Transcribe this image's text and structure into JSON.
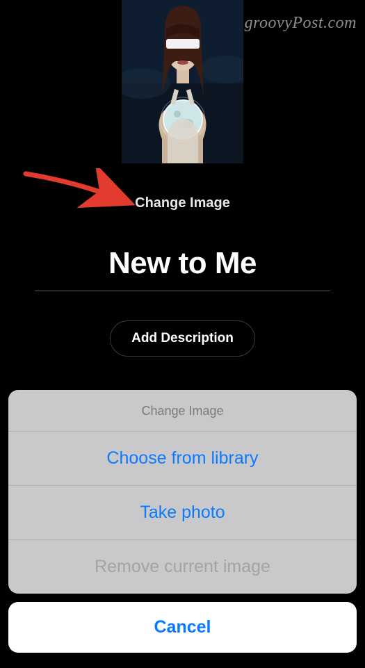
{
  "watermark": "groovyPost.com",
  "editor": {
    "change_image_label": "Change Image",
    "title_value": "New to Me",
    "add_description_label": "Add Description"
  },
  "action_sheet": {
    "title": "Change Image",
    "options": [
      {
        "label": "Choose from library",
        "disabled": false
      },
      {
        "label": "Take photo",
        "disabled": false
      },
      {
        "label": "Remove current image",
        "disabled": true
      }
    ],
    "cancel_label": "Cancel"
  }
}
